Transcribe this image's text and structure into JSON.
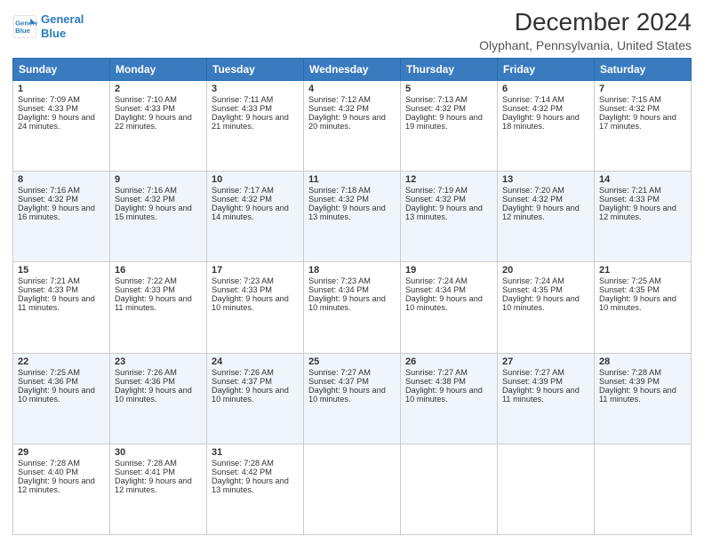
{
  "logo": {
    "line1": "General",
    "line2": "Blue"
  },
  "title": "December 2024",
  "subtitle": "Olyphant, Pennsylvania, United States",
  "days": [
    "Sunday",
    "Monday",
    "Tuesday",
    "Wednesday",
    "Thursday",
    "Friday",
    "Saturday"
  ],
  "weeks": [
    [
      {
        "day": 1,
        "sunrise": "7:09 AM",
        "sunset": "4:33 PM",
        "daylight": "9 hours and 24 minutes."
      },
      {
        "day": 2,
        "sunrise": "7:10 AM",
        "sunset": "4:33 PM",
        "daylight": "9 hours and 22 minutes."
      },
      {
        "day": 3,
        "sunrise": "7:11 AM",
        "sunset": "4:33 PM",
        "daylight": "9 hours and 21 minutes."
      },
      {
        "day": 4,
        "sunrise": "7:12 AM",
        "sunset": "4:32 PM",
        "daylight": "9 hours and 20 minutes."
      },
      {
        "day": 5,
        "sunrise": "7:13 AM",
        "sunset": "4:32 PM",
        "daylight": "9 hours and 19 minutes."
      },
      {
        "day": 6,
        "sunrise": "7:14 AM",
        "sunset": "4:32 PM",
        "daylight": "9 hours and 18 minutes."
      },
      {
        "day": 7,
        "sunrise": "7:15 AM",
        "sunset": "4:32 PM",
        "daylight": "9 hours and 17 minutes."
      }
    ],
    [
      {
        "day": 8,
        "sunrise": "7:16 AM",
        "sunset": "4:32 PM",
        "daylight": "9 hours and 16 minutes."
      },
      {
        "day": 9,
        "sunrise": "7:16 AM",
        "sunset": "4:32 PM",
        "daylight": "9 hours and 15 minutes."
      },
      {
        "day": 10,
        "sunrise": "7:17 AM",
        "sunset": "4:32 PM",
        "daylight": "9 hours and 14 minutes."
      },
      {
        "day": 11,
        "sunrise": "7:18 AM",
        "sunset": "4:32 PM",
        "daylight": "9 hours and 13 minutes."
      },
      {
        "day": 12,
        "sunrise": "7:19 AM",
        "sunset": "4:32 PM",
        "daylight": "9 hours and 13 minutes."
      },
      {
        "day": 13,
        "sunrise": "7:20 AM",
        "sunset": "4:32 PM",
        "daylight": "9 hours and 12 minutes."
      },
      {
        "day": 14,
        "sunrise": "7:21 AM",
        "sunset": "4:33 PM",
        "daylight": "9 hours and 12 minutes."
      }
    ],
    [
      {
        "day": 15,
        "sunrise": "7:21 AM",
        "sunset": "4:33 PM",
        "daylight": "9 hours and 11 minutes."
      },
      {
        "day": 16,
        "sunrise": "7:22 AM",
        "sunset": "4:33 PM",
        "daylight": "9 hours and 11 minutes."
      },
      {
        "day": 17,
        "sunrise": "7:23 AM",
        "sunset": "4:33 PM",
        "daylight": "9 hours and 10 minutes."
      },
      {
        "day": 18,
        "sunrise": "7:23 AM",
        "sunset": "4:34 PM",
        "daylight": "9 hours and 10 minutes."
      },
      {
        "day": 19,
        "sunrise": "7:24 AM",
        "sunset": "4:34 PM",
        "daylight": "9 hours and 10 minutes."
      },
      {
        "day": 20,
        "sunrise": "7:24 AM",
        "sunset": "4:35 PM",
        "daylight": "9 hours and 10 minutes."
      },
      {
        "day": 21,
        "sunrise": "7:25 AM",
        "sunset": "4:35 PM",
        "daylight": "9 hours and 10 minutes."
      }
    ],
    [
      {
        "day": 22,
        "sunrise": "7:25 AM",
        "sunset": "4:36 PM",
        "daylight": "9 hours and 10 minutes."
      },
      {
        "day": 23,
        "sunrise": "7:26 AM",
        "sunset": "4:36 PM",
        "daylight": "9 hours and 10 minutes."
      },
      {
        "day": 24,
        "sunrise": "7:26 AM",
        "sunset": "4:37 PM",
        "daylight": "9 hours and 10 minutes."
      },
      {
        "day": 25,
        "sunrise": "7:27 AM",
        "sunset": "4:37 PM",
        "daylight": "9 hours and 10 minutes."
      },
      {
        "day": 26,
        "sunrise": "7:27 AM",
        "sunset": "4:38 PM",
        "daylight": "9 hours and 10 minutes."
      },
      {
        "day": 27,
        "sunrise": "7:27 AM",
        "sunset": "4:39 PM",
        "daylight": "9 hours and 11 minutes."
      },
      {
        "day": 28,
        "sunrise": "7:28 AM",
        "sunset": "4:39 PM",
        "daylight": "9 hours and 11 minutes."
      }
    ],
    [
      {
        "day": 29,
        "sunrise": "7:28 AM",
        "sunset": "4:40 PM",
        "daylight": "9 hours and 12 minutes."
      },
      {
        "day": 30,
        "sunrise": "7:28 AM",
        "sunset": "4:41 PM",
        "daylight": "9 hours and 12 minutes."
      },
      {
        "day": 31,
        "sunrise": "7:28 AM",
        "sunset": "4:42 PM",
        "daylight": "9 hours and 13 minutes."
      },
      null,
      null,
      null,
      null
    ]
  ],
  "labels": {
    "sunrise": "Sunrise:",
    "sunset": "Sunset:",
    "daylight": "Daylight:"
  }
}
